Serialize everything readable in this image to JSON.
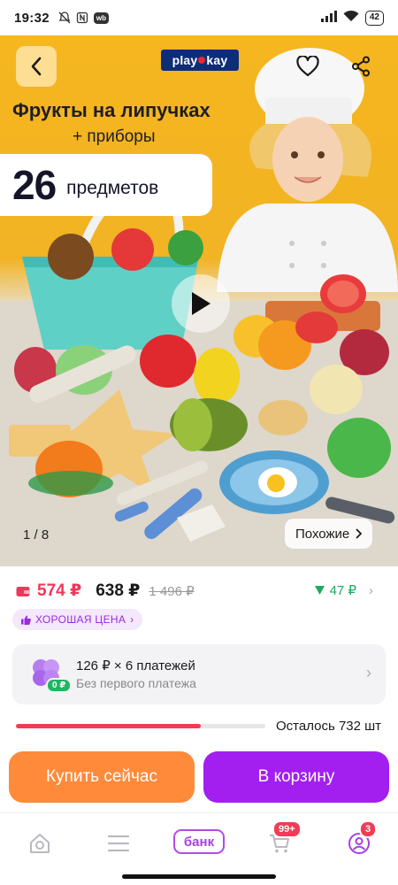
{
  "status_bar": {
    "time": "19:32",
    "badge": "wb",
    "battery": "42"
  },
  "hero": {
    "brand_prefix": "play",
    "brand_suffix": "kay",
    "title": "Фрукты на липучках",
    "subtitle": "+ приборы",
    "count": "26",
    "count_label": "предметов",
    "slide_counter": "1 / 8",
    "similar_label": "Похожие"
  },
  "price": {
    "wallet_price": "574 ₽",
    "main_price": "638 ₽",
    "old_price": "1 496 ₽",
    "cashback": "47 ₽",
    "good_price_label": "ХОРОШАЯ ЦЕНА"
  },
  "split": {
    "badge": "0 ₽",
    "title": "126 ₽ × 6 платежей",
    "subtitle": "Без первого платежа"
  },
  "stock": {
    "remaining_text": "Осталось 732 шт",
    "fill_fraction": 0.74
  },
  "actions": {
    "buy_now": "Купить сейчас",
    "add_to_cart": "В корзину"
  },
  "bottom_nav": {
    "bank_label": "банк",
    "cart_badge": "99+",
    "profile_badge": "3"
  },
  "colors": {
    "accent_purple": "#a21ff0",
    "buy_orange": "#ff8a3a",
    "price_red": "#f0375a",
    "cashback_green": "#20a862"
  }
}
